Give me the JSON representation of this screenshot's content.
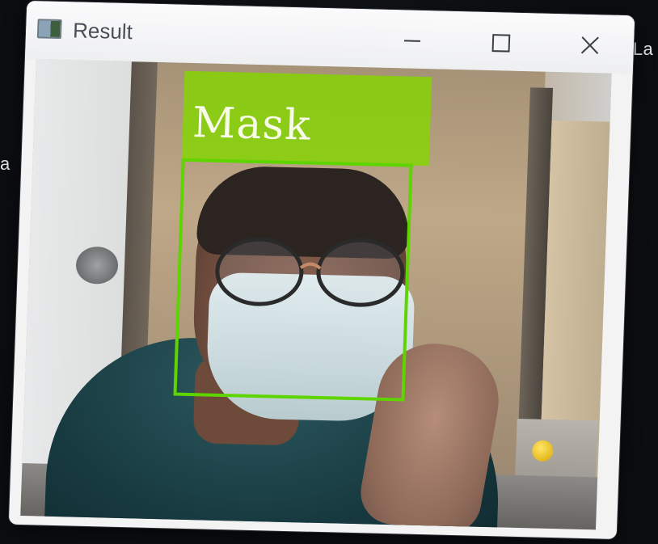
{
  "window": {
    "title": "Result",
    "icon": "app-window-icon"
  },
  "controls": {
    "minimize_icon": "minimize-icon",
    "maximize_icon": "maximize-icon",
    "close_icon": "close-icon"
  },
  "background_windows": {
    "right_fragment": "rLa",
    "left_fragment": "a"
  },
  "detection": {
    "label": "Mask",
    "box_color": "#5ed400",
    "label_bg_color": "#84d600"
  }
}
